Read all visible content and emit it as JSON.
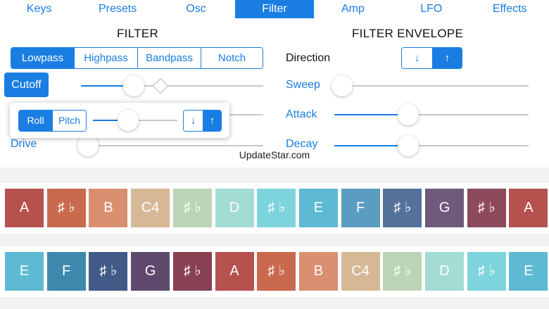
{
  "tabs": [
    {
      "label": "Keys",
      "active": false
    },
    {
      "label": "Presets",
      "active": false
    },
    {
      "label": "Osc",
      "active": false
    },
    {
      "label": "Filter",
      "active": true
    },
    {
      "label": "Amp",
      "active": false
    },
    {
      "label": "LFO",
      "active": false
    },
    {
      "label": "Effects",
      "active": false
    }
  ],
  "filter": {
    "heading": "FILTER",
    "types": [
      "Lowpass",
      "Highpass",
      "Bandpass",
      "Notch"
    ],
    "selected_type": "Lowpass",
    "cutoff_label": "Cutoff",
    "cutoff_level": 0.29,
    "drive_label": "Drive",
    "drive_level": 0.04
  },
  "popover": {
    "modes": [
      "Roll",
      "Pitch"
    ],
    "selected_mode": "Roll",
    "level": 0.42,
    "down_icon": "↓",
    "up_icon": "↑",
    "direction_selected": "up"
  },
  "envelope": {
    "heading": "FILTER ENVELOPE",
    "direction_label": "Direction",
    "down_icon": "↓",
    "up_icon": "↑",
    "direction_selected": "up",
    "sweep_label": "Sweep",
    "sweep_level": 0.04,
    "attack_label": "Attack",
    "attack_level": 0.38,
    "decay_label": "Decay",
    "decay_level": 0.38
  },
  "watermark": "UpdateStar.com",
  "keyboard_row1": [
    {
      "label": "A",
      "color": "#b5524e"
    },
    {
      "label": "♯ ♭",
      "color": "#c9694e"
    },
    {
      "label": "B",
      "color": "#d98f70"
    },
    {
      "label": "C4",
      "color": "#d6b896"
    },
    {
      "label": "♯ ♭",
      "color": "#bcd4b6"
    },
    {
      "label": "D",
      "color": "#a3dcd2"
    },
    {
      "label": "♯ ♭",
      "color": "#7ed4dc"
    },
    {
      "label": "E",
      "color": "#5dbad2"
    },
    {
      "label": "F",
      "color": "#5a9dc0"
    },
    {
      "label": "♯ ♭",
      "color": "#55729c"
    },
    {
      "label": "G",
      "color": "#6f5a7c"
    },
    {
      "label": "♯ ♭",
      "color": "#8e4a5c"
    },
    {
      "label": "A",
      "color": "#b5524e"
    }
  ],
  "keyboard_row2": [
    {
      "label": "E",
      "color": "#5dbad2"
    },
    {
      "label": "F",
      "color": "#3f88ad"
    },
    {
      "label": "♯ ♭",
      "color": "#415a88"
    },
    {
      "label": "G",
      "color": "#5f4a6e"
    },
    {
      "label": "♯ ♭",
      "color": "#884053"
    },
    {
      "label": "A",
      "color": "#b5524e"
    },
    {
      "label": "♯ ♭",
      "color": "#c9694e"
    },
    {
      "label": "B",
      "color": "#d98f70"
    },
    {
      "label": "C4",
      "color": "#d6b896"
    },
    {
      "label": "♯ ♭",
      "color": "#bcd4b6"
    },
    {
      "label": "D",
      "color": "#a3dcd2"
    },
    {
      "label": "♯ ♭",
      "color": "#7ed4dc"
    },
    {
      "label": "E",
      "color": "#5dbad2"
    }
  ]
}
